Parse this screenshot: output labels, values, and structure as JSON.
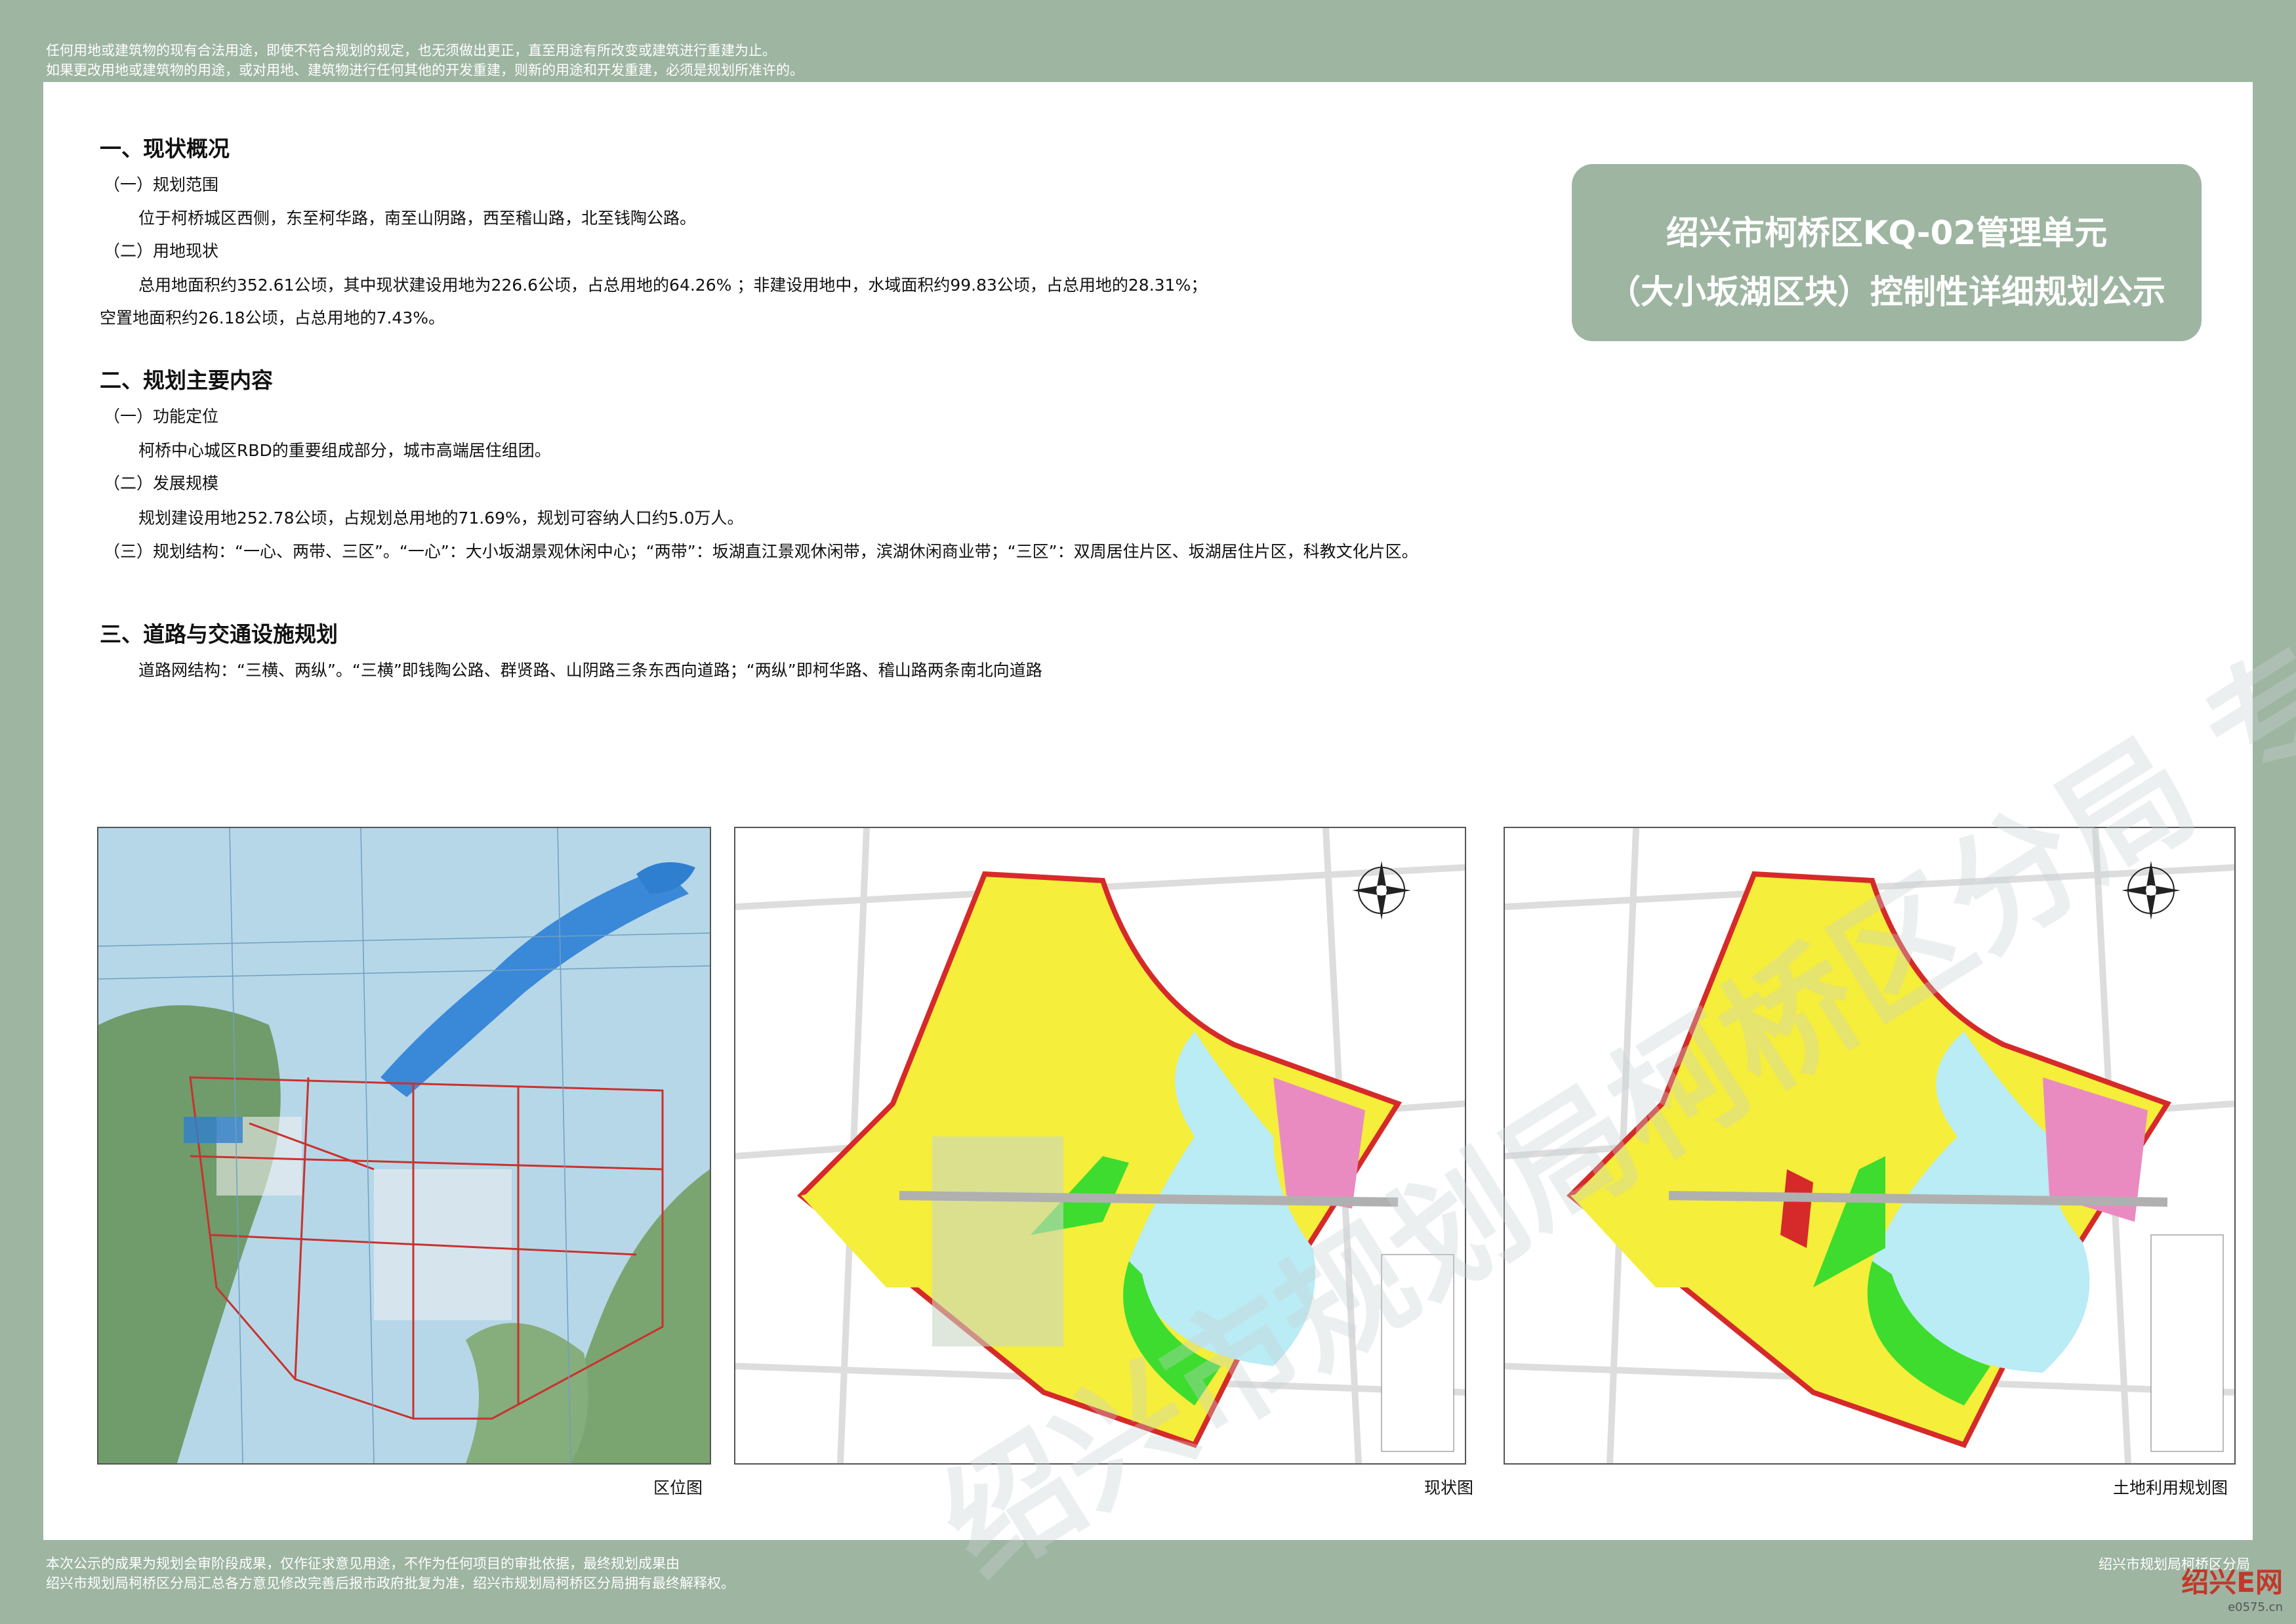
{
  "notice_top": [
    "任何用地或建筑物的现有合法用途，即使不符合规划的规定，也无须做出更正，直至用途有所改变或建筑进行重建为止。",
    "如果更改用地或建筑物的用途，或对用地、建筑物进行任何其他的开发重建，则新的用途和开发重建，必须是规划所准许的。"
  ],
  "title": {
    "line1": "绍兴市柯桥区KQ-02管理单元",
    "line2": "（大小坂湖区块）控制性详细规划公示"
  },
  "sections": {
    "s1": {
      "heading": "一、现状概况",
      "sub1": "（一）规划范围",
      "sub1_text": "位于柯桥城区西侧，东至柯华路，南至山阴路，西至稽山路，北至钱陶公路。",
      "sub2": "（二）用地现状",
      "sub2_text1": "总用地面积约352.61公顷，其中现状建设用地为226.6公顷，占总用地的64.26% ；非建设用地中，水域面积约99.83公顷，占总用地的28.31%；",
      "sub2_text2": "空置地面积约26.18公顷，占总用地的7.43%。"
    },
    "s2": {
      "heading": "二、规划主要内容",
      "sub1": "（一）功能定位",
      "sub1_text": "柯桥中心城区RBD的重要组成部分，城市高端居住组团。",
      "sub2": "（二）发展规模",
      "sub2_text": "规划建设用地252.78公顷，占规划总用地的71.69%，规划可容纳人口约5.0万人。",
      "sub3": "（三）规划结构：“一心、两带、三区”。“一心”：大小坂湖景观休闲中心；“两带”：坂湖直江景观休闲带，滨湖休闲商业带；“三区”：双周居住片区、坂湖居住片区，科教文化片区。"
    },
    "s3": {
      "heading": "三、道路与交通设施规划",
      "text": "道路网结构：“三横、两纵”。“三横”即钱陶公路、群贤路、山阴路三条东西向道路；“两纵”即柯华路、稽山路两条南北向道路"
    }
  },
  "maps": {
    "m1_caption": "区位图",
    "m2_caption": "现状图",
    "m3_caption": "土地利用规划图"
  },
  "notice_bottom": [
    "本次公示的成果为规划会审阶段成果，仅作征求意见用途，不作为任何项目的审批依据，最终规划成果由",
    "绍兴市规划局柯桥区分局汇总各方意见修改完善后报市政府批复为准，绍兴市规划局柯桥区分局拥有最终解释权。"
  ],
  "office": "绍兴市规划局柯桥区分局",
  "watermark": "绍兴市规划局柯桥区分局 专用图片",
  "logo": {
    "name": "绍兴E网",
    "domain": "e0575.cn"
  },
  "colors": {
    "frame": "#9eb5a2",
    "residential": "#f5ee3a",
    "commercial": "#e98bc1",
    "green": "#3ddc2f",
    "water": "#b9ecf4",
    "road_red": "#d62a2a"
  }
}
